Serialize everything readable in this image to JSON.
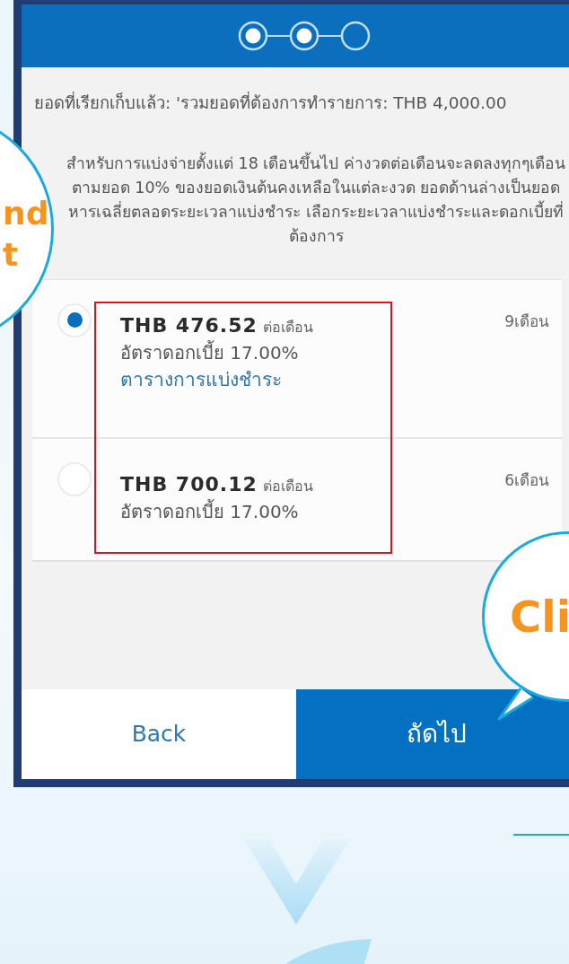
{
  "stepper": {
    "steps": [
      {
        "completed": true
      },
      {
        "completed": true
      },
      {
        "completed": false
      }
    ]
  },
  "summary": "ยอดที่เรียกเก็บแล้ว: 'รวมยอดที่ต้องการทำรายการ: THB 4,000.00",
  "note": "สำหรับการแบ่งจ่ายตั้งแต่ 18 เดือนขึ้นไป ค่างวดต่อเดือนจะลดลงทุกๆเดือน ตามยอด 10% ของยอดเงินต้นคงเหลือในแต่ละงวด ยอดด้านล่างเป็นยอดหารเฉลี่ยตลอดระยะเวลาแบ่งชำระ เลือกระยะเวลาแบ่งชำระและดอกเบี้ยที่ต้องการ",
  "plans": [
    {
      "amount": "THB 476.52",
      "per": "ต่อเดือน",
      "rate": "อัตราดอกเบี้ย 17.00%",
      "link": "ตารางการแบ่งชำระ",
      "term": "9เดือน",
      "selected": true
    },
    {
      "amount": "THB 700.12",
      "per": "ต่อเดือน",
      "rate": "อัตราดอกเบี้ย 17.00%",
      "term": "6เดือน",
      "selected": false
    }
  ],
  "buttons": [
    {
      "label": "Back",
      "kind": "secondary"
    },
    {
      "label": "ถัดไป",
      "kind": "primary"
    }
  ],
  "callouts": [
    {
      "lines": [
        "nd",
        "t"
      ]
    },
    {
      "lines": [
        "Cli"
      ]
    }
  ]
}
